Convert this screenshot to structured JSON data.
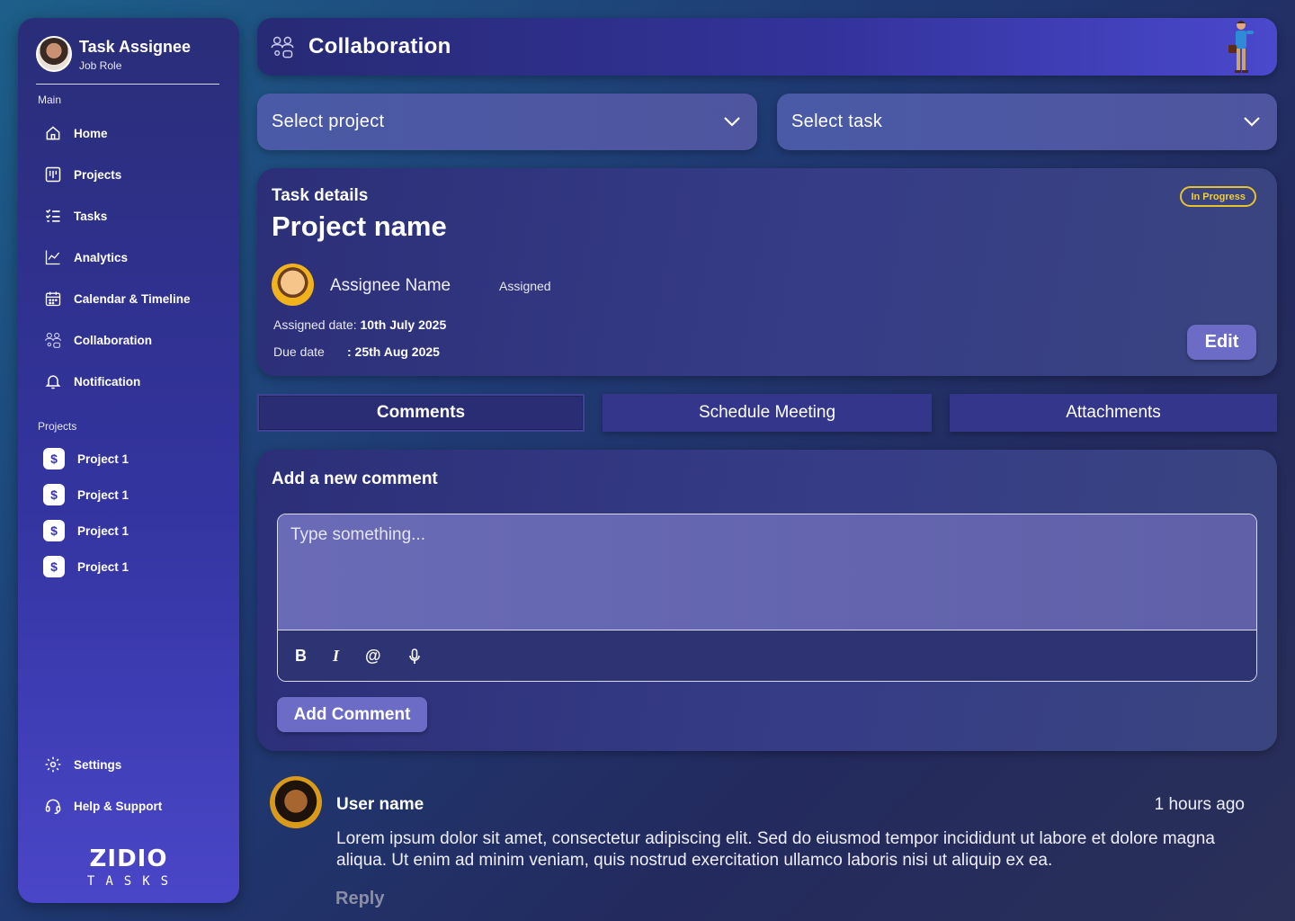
{
  "sidebar": {
    "profile": {
      "name": "Task Assignee",
      "role": "Job Role"
    },
    "main_label": "Main",
    "nav": [
      {
        "label": "Home",
        "icon": "home-icon"
      },
      {
        "label": "Projects",
        "icon": "kanban-icon"
      },
      {
        "label": "Tasks",
        "icon": "checklist-icon"
      },
      {
        "label": "Analytics",
        "icon": "chart-icon"
      },
      {
        "label": "Calendar & Timeline",
        "icon": "calendar-icon"
      },
      {
        "label": "Collaboration",
        "icon": "collaboration-icon"
      },
      {
        "label": "Notification",
        "icon": "bell-icon"
      }
    ],
    "projects_label": "Projects",
    "projects": [
      {
        "label": "Project 1"
      },
      {
        "label": "Project 1"
      },
      {
        "label": "Project 1"
      },
      {
        "label": "Project 1"
      }
    ],
    "bottom": [
      {
        "label": "Settings",
        "icon": "gear-icon"
      },
      {
        "label": "Help & Support",
        "icon": "headset-icon"
      }
    ],
    "logo": {
      "main": "ZIDIO",
      "sub": "TASKS"
    }
  },
  "header": {
    "title": "Collaboration"
  },
  "selects": {
    "project_placeholder": "Select project",
    "task_placeholder": "Select task"
  },
  "task": {
    "section_label": "Task details",
    "project_name": "Project name",
    "status": "In Progress",
    "assignee_name": "Assignee Name",
    "assigned_label": "Assigned",
    "assigned_date_label": "Assigned date:",
    "assigned_date": "10th July 2025",
    "due_date_label": "Due date",
    "due_date": ": 25th Aug 2025",
    "edit_label": "Edit"
  },
  "tabs": [
    {
      "label": "Comments",
      "active": true
    },
    {
      "label": "Schedule Meeting",
      "active": false
    },
    {
      "label": "Attachments",
      "active": false
    }
  ],
  "comment_form": {
    "label": "Add a new comment",
    "placeholder": "Type something...",
    "tools": {
      "bold": "B",
      "italic": "I",
      "mention": "@"
    },
    "submit_label": "Add Comment"
  },
  "comments": [
    {
      "user": "User name",
      "time": "1 hours ago",
      "body": "Lorem ipsum dolor sit amet, consectetur adipiscing elit. Sed do eiusmod tempor incididunt ut labore et dolore magna aliqua. Ut enim ad minim veniam, quis nostrud exercitation ullamco laboris nisi ut aliquip ex ea.",
      "reply_label": "Reply"
    }
  ],
  "colors": {
    "accent": "#6c6cc6",
    "status_in_progress": "#e7c32b",
    "sidebar_bottom": "#4a46c8"
  }
}
